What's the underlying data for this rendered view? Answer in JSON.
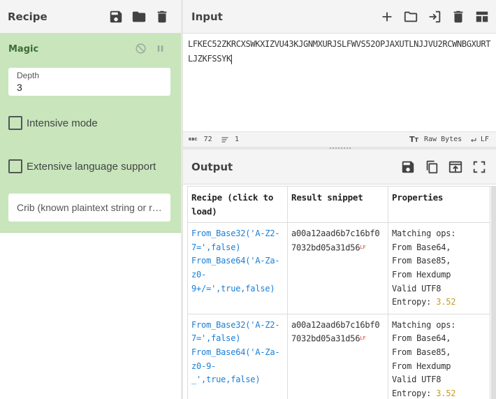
{
  "recipe": {
    "title": "Recipe",
    "icons": [
      "save-icon",
      "folder-icon",
      "trash-icon"
    ],
    "operation": {
      "name": "Magic",
      "depth_label": "Depth",
      "depth_value": "3",
      "intensive_label": "Intensive mode",
      "extensive_label": "Extensive language support",
      "crib_placeholder": "Crib (known plaintext string or regex)"
    }
  },
  "input": {
    "title": "Input",
    "icons": [
      "plus-icon",
      "open-folder-icon",
      "open-file-icon",
      "trash-icon",
      "layout-icon"
    ],
    "text": "LFKEC52ZKRCXSWKXIZVU43KJGNMXURJSLFWVS52OPJAXUTLNJJVU2RCWNBGXURTLJZKFSSYK",
    "status": {
      "length_label": "72",
      "lines_label": "1",
      "raw_bytes": "Raw Bytes",
      "eol": "LF"
    }
  },
  "output": {
    "title": "Output",
    "icons": [
      "save-icon",
      "copy-icon",
      "replace-input-icon",
      "fullscreen-icon"
    ],
    "table": {
      "headers": [
        "Recipe (click to load)",
        "Result snippet",
        "Properties"
      ],
      "rows": [
        {
          "recipe": "From_Base32('A-Z2-7=',false) From_Base64('A-Za-z0-9+/=',true,false)",
          "snippet": "a00a12aad6b7c16bf07032bd05a31d56",
          "snippet_eol": "LF",
          "properties": "Matching ops:\nFrom Base64,\nFrom Base85,\nFrom Hexdump\nValid UTF8",
          "entropy_label": "Entropy:",
          "entropy_value": "3.52"
        },
        {
          "recipe": "From_Base32('A-Z2-7=',false) From_Base64('A-Za-z0-9-_',true,false)",
          "snippet": "a00a12aad6b7c16bf07032bd05a31d56",
          "snippet_eol": "LF",
          "properties": "Matching ops:\nFrom Base64,\nFrom Base85,\nFrom Hexdump\nValid UTF8",
          "entropy_label": "Entropy:",
          "entropy_value": "3.52"
        }
      ]
    }
  },
  "colors": {
    "operation_bg": "#c8e5bc",
    "operation_title": "#3f6b35",
    "recipe_link": "#1a7ed6",
    "entropy": "#c59b22"
  }
}
